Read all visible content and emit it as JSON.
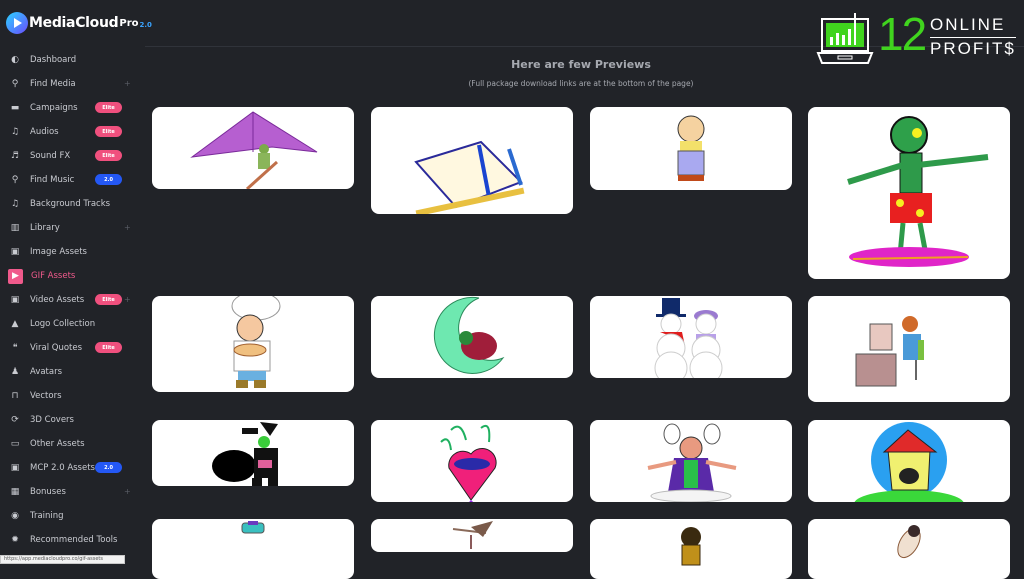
{
  "app": {
    "logo_text": "MediaCloud",
    "logo_pro": "Pro",
    "logo_version": "2.0"
  },
  "brand": {
    "number": "12",
    "line1": "ONLINE",
    "line2": "PROFIT$"
  },
  "sidebar": {
    "items": [
      {
        "label": "Dashboard",
        "icon": "dashboard-icon",
        "glyph": "◐"
      },
      {
        "label": "Find Media",
        "icon": "search-icon",
        "glyph": "⚲",
        "expandable": true
      },
      {
        "label": "Campaigns",
        "icon": "briefcase-icon",
        "glyph": "▬",
        "badge": "Elite"
      },
      {
        "label": "Audios",
        "icon": "music-icon",
        "glyph": "♫",
        "badge": "Elite"
      },
      {
        "label": "Sound FX",
        "icon": "sound-fx-icon",
        "glyph": "♬",
        "badge": "Elite"
      },
      {
        "label": "Find Music",
        "icon": "search-icon",
        "glyph": "⚲",
        "badge": "2.0"
      },
      {
        "label": "Background Tracks",
        "icon": "music-icon",
        "glyph": "♫"
      },
      {
        "label": "Library",
        "icon": "library-icon",
        "glyph": "▥",
        "expandable": true
      },
      {
        "label": "Image Assets",
        "icon": "image-icon",
        "glyph": "▣"
      },
      {
        "label": "GIF Assets",
        "icon": "gif-icon",
        "glyph": "▶",
        "active": true
      },
      {
        "label": "Video Assets",
        "icon": "video-icon",
        "glyph": "▣",
        "badge": "Elite",
        "expandable": true
      },
      {
        "label": "Logo Collection",
        "icon": "fire-icon",
        "glyph": "▲"
      },
      {
        "label": "Viral Quotes",
        "icon": "quote-icon",
        "glyph": "❝",
        "badge": "Elite"
      },
      {
        "label": "Avatars",
        "icon": "avatar-icon",
        "glyph": "♟"
      },
      {
        "label": "Vectors",
        "icon": "vector-icon",
        "glyph": "⊓"
      },
      {
        "label": "3D Covers",
        "icon": "3d-cover-icon",
        "glyph": "⟳"
      },
      {
        "label": "Other Assets",
        "icon": "window-icon",
        "glyph": "▭"
      },
      {
        "label": "MCP 2.0 Assets",
        "icon": "image-icon",
        "glyph": "▣",
        "badge": "2.0"
      },
      {
        "label": "Bonuses",
        "icon": "gift-icon",
        "glyph": "▦",
        "expandable": true
      },
      {
        "label": "Training",
        "icon": "training-icon",
        "glyph": "◉"
      },
      {
        "label": "Recommended Tools",
        "icon": "gear-icon",
        "glyph": "✹"
      }
    ]
  },
  "status_bar": {
    "url": "https://app.mediacloudpro.co/gif-assets"
  },
  "main": {
    "title": "Here are few Previews",
    "subtitle": "(Full package download links are at the bottom of the page)",
    "previews": [
      {
        "name": "hang-glider"
      },
      {
        "name": "open-book-with-pen"
      },
      {
        "name": "sad-boy-in-overalls"
      },
      {
        "name": "zombie-surfer"
      },
      {
        "name": "chef-with-pie"
      },
      {
        "name": "baby-on-moon"
      },
      {
        "name": "snowman-couple"
      },
      {
        "name": "woman-typing-at-computer"
      },
      {
        "name": "witch-with-cauldron"
      },
      {
        "name": "carnival-heart-mask"
      },
      {
        "name": "horned-wizard"
      },
      {
        "name": "happy-house"
      },
      {
        "name": "car"
      },
      {
        "name": "hummingbird"
      },
      {
        "name": "monkey"
      },
      {
        "name": "astronaut"
      }
    ]
  },
  "colors": {
    "background": "#212328",
    "accent_pink": "#f05a8c",
    "badge_blue": "#2458f5",
    "brand_green": "#40d41e"
  }
}
